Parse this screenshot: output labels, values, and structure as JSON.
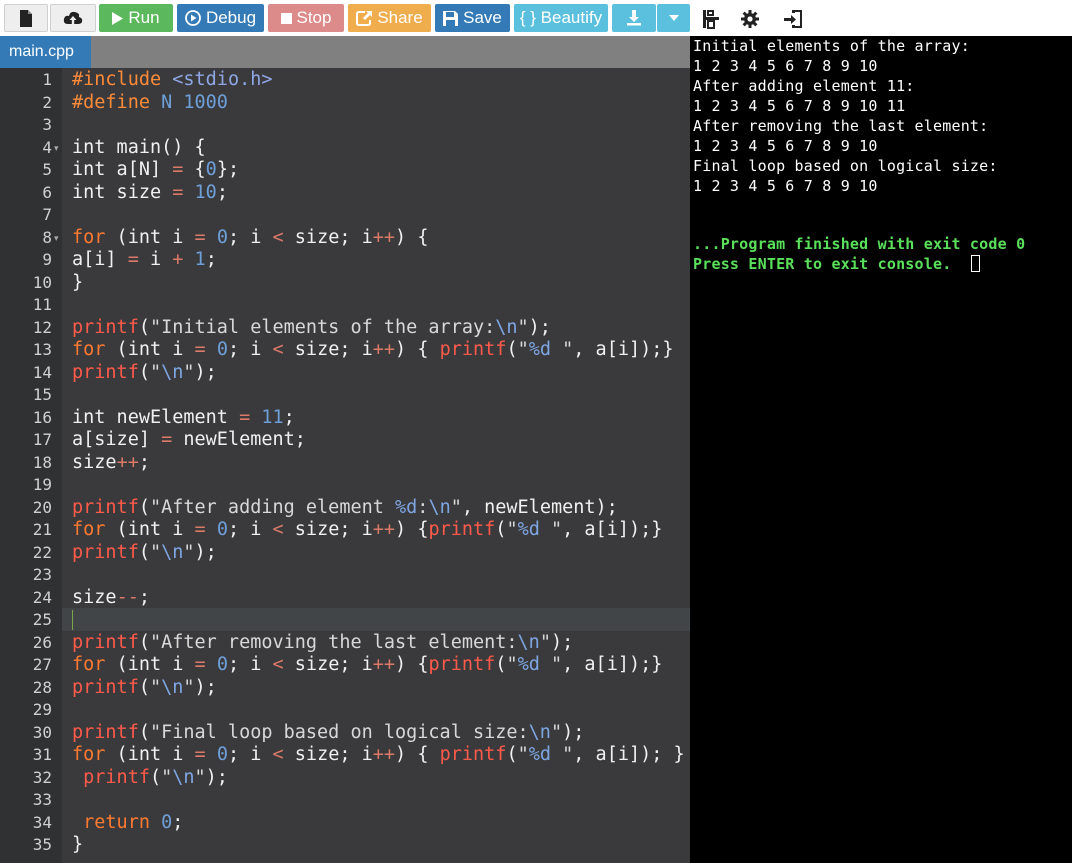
{
  "toolbar": {
    "run_label": "Run",
    "debug_label": "Debug",
    "stop_label": "Stop",
    "share_label": "Share",
    "save_label": "Save",
    "beautify_label": "{ } Beautify"
  },
  "icons": {
    "file": "file-icon",
    "upload": "upload-icon",
    "run": "play-icon",
    "debug": "debug-icon",
    "stop": "stop-icon",
    "share": "share-icon",
    "save": "save-icon",
    "download": "download-icon",
    "dropdown": "caret-down-icon",
    "layout": "layout-icon",
    "settings": "gear-icon",
    "input": "stdin-icon"
  },
  "colors": {
    "run": "#5cb85c",
    "debug": "#337ab7",
    "stop": "#dd8a8a",
    "share": "#f0ad4e",
    "save": "#337ab7",
    "beautify": "#5bc0de",
    "tab_active": "#337ab7",
    "editor_bg": "#3a3a3c",
    "console_bg": "#000000",
    "console_success": "#5ae05a"
  },
  "editor": {
    "tab_name": "main.cpp",
    "line_numbers": [
      "1",
      "2",
      "3",
      "4",
      "5",
      "6",
      "7",
      "8",
      "9",
      "10",
      "11",
      "12",
      "13",
      "14",
      "15",
      "16",
      "17",
      "18",
      "19",
      "20",
      "21",
      "22",
      "23",
      "24",
      "25",
      "26",
      "27",
      "28",
      "29",
      "30",
      "31",
      "32",
      "33",
      "34",
      "35"
    ],
    "lines": [
      [
        [
          "pp",
          "#include "
        ],
        [
          "hd",
          "<stdio.h>"
        ]
      ],
      [
        [
          "pp",
          "#define "
        ],
        [
          "num",
          "N 1000"
        ]
      ],
      [],
      [
        [
          "va",
          "int"
        ],
        [
          "pl",
          " main() {"
        ]
      ],
      [
        [
          "va",
          "int"
        ],
        [
          "pl",
          " a[N] "
        ],
        [
          "op",
          "="
        ],
        [
          "pl",
          " {"
        ],
        [
          "num",
          "0"
        ],
        [
          "pl",
          "};"
        ]
      ],
      [
        [
          "va",
          "int"
        ],
        [
          "pl",
          " size "
        ],
        [
          "op",
          "="
        ],
        [
          "pl",
          " "
        ],
        [
          "num",
          "10"
        ],
        [
          "pl",
          ";"
        ]
      ],
      [],
      [
        [
          "kw",
          "for"
        ],
        [
          "pl",
          " (int i "
        ],
        [
          "op",
          "="
        ],
        [
          "pl",
          " "
        ],
        [
          "num",
          "0"
        ],
        [
          "pl",
          "; i "
        ],
        [
          "op",
          "<"
        ],
        [
          "pl",
          " size; i"
        ],
        [
          "op",
          "++"
        ],
        [
          "pl",
          ") {"
        ]
      ],
      [
        [
          "pl",
          "a[i] "
        ],
        [
          "op",
          "="
        ],
        [
          "pl",
          " i "
        ],
        [
          "op",
          "+"
        ],
        [
          "pl",
          " "
        ],
        [
          "num",
          "1"
        ],
        [
          "pl",
          ";"
        ]
      ],
      [
        [
          "pl",
          "}"
        ]
      ],
      [],
      [
        [
          "fn",
          "printf"
        ],
        [
          "pl",
          "("
        ],
        [
          "str",
          "\"Initial elements of the array:"
        ],
        [
          "esc",
          "\\n"
        ],
        [
          "str",
          "\""
        ],
        [
          "pl",
          ");"
        ]
      ],
      [
        [
          "kw",
          "for"
        ],
        [
          "pl",
          " (int i "
        ],
        [
          "op",
          "="
        ],
        [
          "pl",
          " "
        ],
        [
          "num",
          "0"
        ],
        [
          "pl",
          "; i "
        ],
        [
          "op",
          "<"
        ],
        [
          "pl",
          " size; i"
        ],
        [
          "op",
          "++"
        ],
        [
          "pl",
          ") { "
        ],
        [
          "fn",
          "printf"
        ],
        [
          "pl",
          "("
        ],
        [
          "str",
          "\""
        ],
        [
          "esc",
          "%d"
        ],
        [
          "str",
          " \""
        ],
        [
          "pl",
          ", a[i]);}"
        ]
      ],
      [
        [
          "fn",
          "printf"
        ],
        [
          "pl",
          "("
        ],
        [
          "str",
          "\""
        ],
        [
          "esc",
          "\\n"
        ],
        [
          "str",
          "\""
        ],
        [
          "pl",
          ");"
        ]
      ],
      [],
      [
        [
          "va",
          "int"
        ],
        [
          "pl",
          " newElement "
        ],
        [
          "op",
          "="
        ],
        [
          "pl",
          " "
        ],
        [
          "num",
          "11"
        ],
        [
          "pl",
          ";"
        ]
      ],
      [
        [
          "pl",
          "a[size] "
        ],
        [
          "op",
          "="
        ],
        [
          "pl",
          " newElement;"
        ]
      ],
      [
        [
          "pl",
          "size"
        ],
        [
          "op",
          "++"
        ],
        [
          "pl",
          ";"
        ]
      ],
      [],
      [
        [
          "fn",
          "printf"
        ],
        [
          "pl",
          "("
        ],
        [
          "str",
          "\"After adding element "
        ],
        [
          "esc",
          "%d"
        ],
        [
          "str",
          ":"
        ],
        [
          "esc",
          "\\n"
        ],
        [
          "str",
          "\""
        ],
        [
          "pl",
          ", newElement);"
        ]
      ],
      [
        [
          "kw",
          "for"
        ],
        [
          "pl",
          " (int i "
        ],
        [
          "op",
          "="
        ],
        [
          "pl",
          " "
        ],
        [
          "num",
          "0"
        ],
        [
          "pl",
          "; i "
        ],
        [
          "op",
          "<"
        ],
        [
          "pl",
          " size; i"
        ],
        [
          "op",
          "++"
        ],
        [
          "pl",
          ") {"
        ],
        [
          "fn",
          "printf"
        ],
        [
          "pl",
          "("
        ],
        [
          "str",
          "\""
        ],
        [
          "esc",
          "%d"
        ],
        [
          "str",
          " \""
        ],
        [
          "pl",
          ", a[i]);}"
        ]
      ],
      [
        [
          "fn",
          "printf"
        ],
        [
          "pl",
          "("
        ],
        [
          "str",
          "\""
        ],
        [
          "esc",
          "\\n"
        ],
        [
          "str",
          "\""
        ],
        [
          "pl",
          ");"
        ]
      ],
      [],
      [
        [
          "pl",
          "size"
        ],
        [
          "op",
          "--"
        ],
        [
          "pl",
          ";"
        ]
      ],
      [],
      [
        [
          "fn",
          "printf"
        ],
        [
          "pl",
          "("
        ],
        [
          "str",
          "\"After removing the last element:"
        ],
        [
          "esc",
          "\\n"
        ],
        [
          "str",
          "\""
        ],
        [
          "pl",
          ");"
        ]
      ],
      [
        [
          "kw",
          "for"
        ],
        [
          "pl",
          " (int i "
        ],
        [
          "op",
          "="
        ],
        [
          "pl",
          " "
        ],
        [
          "num",
          "0"
        ],
        [
          "pl",
          "; i "
        ],
        [
          "op",
          "<"
        ],
        [
          "pl",
          " size; i"
        ],
        [
          "op",
          "++"
        ],
        [
          "pl",
          ") {"
        ],
        [
          "fn",
          "printf"
        ],
        [
          "pl",
          "("
        ],
        [
          "str",
          "\""
        ],
        [
          "esc",
          "%d"
        ],
        [
          "str",
          " \""
        ],
        [
          "pl",
          ", a[i]);}"
        ]
      ],
      [
        [
          "fn",
          "printf"
        ],
        [
          "pl",
          "("
        ],
        [
          "str",
          "\""
        ],
        [
          "esc",
          "\\n"
        ],
        [
          "str",
          "\""
        ],
        [
          "pl",
          ");"
        ]
      ],
      [],
      [
        [
          "fn",
          "printf"
        ],
        [
          "pl",
          "("
        ],
        [
          "str",
          "\"Final loop based on logical size:"
        ],
        [
          "esc",
          "\\n"
        ],
        [
          "str",
          "\""
        ],
        [
          "pl",
          ");"
        ]
      ],
      [
        [
          "kw",
          "for"
        ],
        [
          "pl",
          " (int i "
        ],
        [
          "op",
          "="
        ],
        [
          "pl",
          " "
        ],
        [
          "num",
          "0"
        ],
        [
          "pl",
          "; i "
        ],
        [
          "op",
          "<"
        ],
        [
          "pl",
          " size; i"
        ],
        [
          "op",
          "++"
        ],
        [
          "pl",
          ") { "
        ],
        [
          "fn",
          "printf"
        ],
        [
          "pl",
          "("
        ],
        [
          "str",
          "\""
        ],
        [
          "esc",
          "%d"
        ],
        [
          "str",
          " \""
        ],
        [
          "pl",
          ", a[i]); }"
        ]
      ],
      [
        [
          "pl",
          " "
        ],
        [
          "fn",
          "printf"
        ],
        [
          "pl",
          "("
        ],
        [
          "str",
          "\""
        ],
        [
          "esc",
          "\\n"
        ],
        [
          "str",
          "\""
        ],
        [
          "pl",
          ");"
        ]
      ],
      [],
      [
        [
          "pl",
          " "
        ],
        [
          "kw",
          "return"
        ],
        [
          "pl",
          " "
        ],
        [
          "num",
          "0"
        ],
        [
          "pl",
          ";"
        ]
      ],
      [
        [
          "pl",
          "}"
        ]
      ]
    ]
  },
  "console": {
    "lines": [
      "Initial elements of the array:",
      "1 2 3 4 5 6 7 8 9 10",
      "After adding element 11:",
      "1 2 3 4 5 6 7 8 9 10 11",
      "After removing the last element:",
      "1 2 3 4 5 6 7 8 9 10",
      "Final loop based on logical size:",
      "1 2 3 4 5 6 7 8 9 10"
    ],
    "finished_message": "...Program finished with exit code 0",
    "exit_prompt": "Press ENTER to exit console."
  }
}
